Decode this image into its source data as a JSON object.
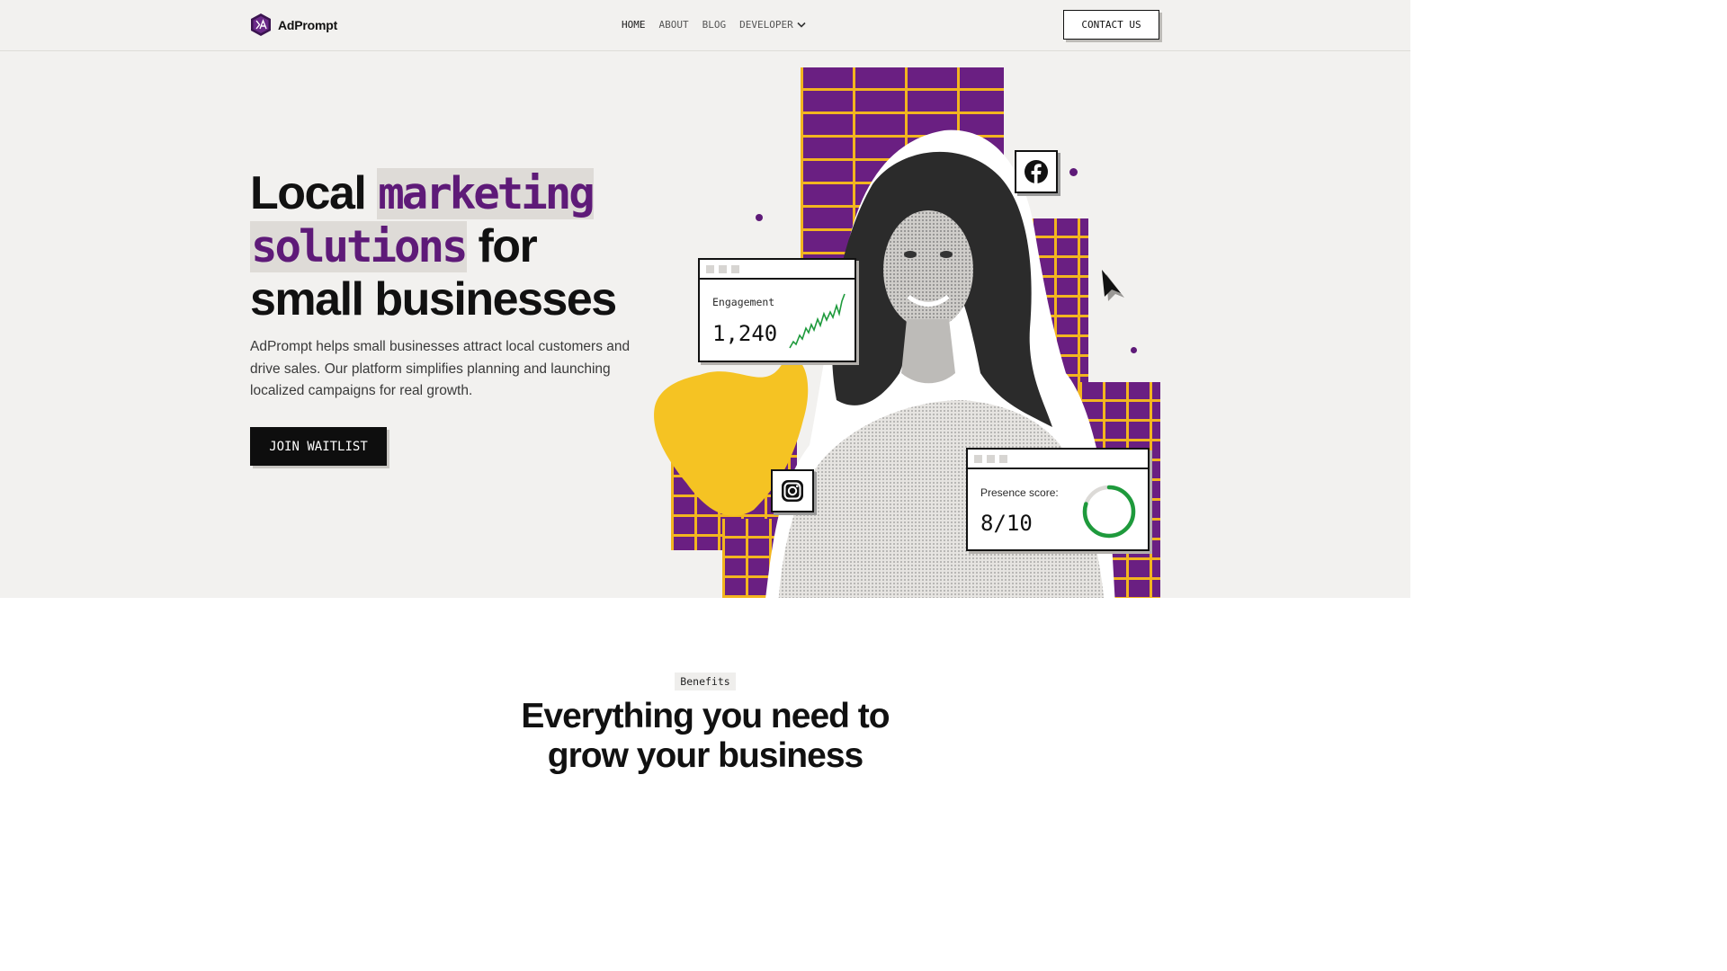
{
  "nav": {
    "logo_text": "AdPrompt",
    "links": [
      "HOME",
      "ABOUT",
      "BLOG",
      "DEVELOPER"
    ],
    "contact_label": "CONTACT US"
  },
  "hero": {
    "headline_1": "Local ",
    "headline_hl_1": "marketing",
    "headline_hl_2": "solutions",
    "headline_2": " for",
    "headline_3": "small businesses",
    "subtitle": "AdPrompt helps small businesses attract local customers and drive sales. Our platform simplifies planning and launching localized campaigns for real growth.",
    "cta_label": "JOIN WAITLIST",
    "engagement_card": {
      "label": "Engagement",
      "value": "1,240"
    },
    "presence_card": {
      "label": "Presence score:",
      "value": "8/10",
      "score_fraction": 0.8
    },
    "social_icons": [
      "facebook-icon",
      "instagram-icon"
    ]
  },
  "benefits": {
    "badge": "Benefits",
    "title_1": "Everything you need to",
    "title_2": "grow your business"
  },
  "colors": {
    "purple": "#5e1a78",
    "yellow": "#f2b51f",
    "accent_green": "#1e9a3c",
    "background": "#f2f1ef"
  }
}
